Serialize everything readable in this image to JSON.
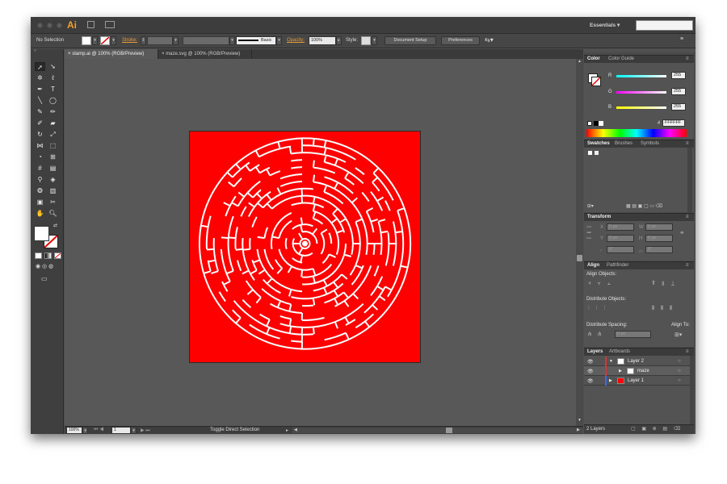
{
  "app": {
    "logo": "Ai",
    "workspace": "Essentials ▾",
    "search_placeholder": ""
  },
  "control_bar": {
    "selection": "No Selection",
    "stroke_label": "Stroke:",
    "brush_label": "Basic",
    "opacity_label": "Opacity:",
    "opacity_value": "100%",
    "style_label": "Style:",
    "document_setup": "Document Setup",
    "preferences": "Preferences"
  },
  "tabs": [
    {
      "label": "stamp.ai @ 100% (RGB/Preview)",
      "close": "×"
    },
    {
      "label": "maze.svg @ 100% (RGB/Preview)",
      "close": "×"
    }
  ],
  "status": {
    "zoom": "100%",
    "page": "1",
    "message": "Toggle Direct Selection"
  },
  "color_panel": {
    "tabs": [
      "Color",
      "Color Guide"
    ],
    "r_label": "R",
    "g_label": "G",
    "b_label": "B",
    "r": "255",
    "g": "255",
    "b": "255",
    "hex_label": "#",
    "hex": "FFFFFF"
  },
  "swatches_panel": {
    "tabs": [
      "Swatches",
      "Brushes",
      "Symbols"
    ]
  },
  "transform_panel": {
    "title": "Transform",
    "x_label": "X",
    "y_label": "Y",
    "w_label": "W",
    "h_label": "H",
    "x": "0 px",
    "y": "0 px",
    "w": "0 px",
    "h": "0 px",
    "angle": "0°",
    "shear": "0°"
  },
  "align_panel": {
    "tabs": [
      "Align",
      "Pathfinder"
    ],
    "align_objects": "Align Objects:",
    "distribute_objects": "Distribute Objects:",
    "distribute_spacing": "Distribute Spacing:",
    "align_to": "Align To:",
    "spacing_value": "0 px"
  },
  "layers_panel": {
    "tabs": [
      "Layers",
      "Artboards"
    ],
    "layers": [
      {
        "name": "Layer 2",
        "color": "#e03030"
      },
      {
        "name": "maze",
        "color": "#e03030"
      },
      {
        "name": "Layer 1",
        "color": "#3a6cf0"
      }
    ],
    "count": "2 Layers"
  },
  "artwork": {
    "background": "#ff0000",
    "maze_color": "#ffffff"
  }
}
